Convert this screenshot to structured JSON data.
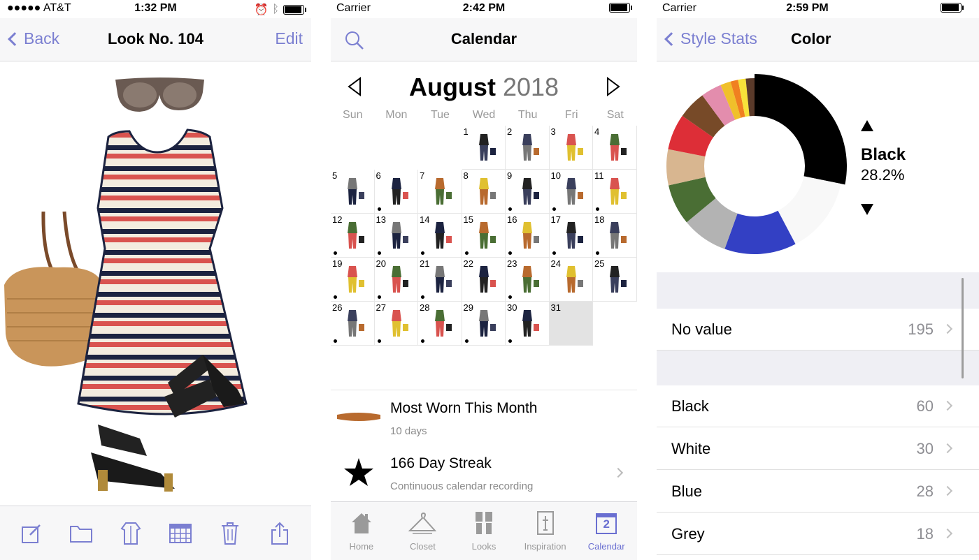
{
  "screen1": {
    "status": {
      "carrier": "●●●●● AT&T",
      "time": "1:32 PM"
    },
    "nav": {
      "back_label": "Back",
      "title": "Look No. 104",
      "edit_label": "Edit"
    },
    "toolbar": [
      "compose-icon",
      "folder-icon",
      "outfit-icon",
      "calendar-grid-icon",
      "trash-icon",
      "share-icon"
    ]
  },
  "screen2": {
    "status": {
      "carrier": "Carrier",
      "time": "2:42 PM"
    },
    "nav": {
      "title": "Calendar"
    },
    "month": "August",
    "year": "2018",
    "weekdays": [
      "Sun",
      "Mon",
      "Tue",
      "Wed",
      "Thu",
      "Fri",
      "Sat"
    ],
    "days": [
      {
        "d": "1"
      },
      {
        "d": "2"
      },
      {
        "d": "3"
      },
      {
        "d": "4"
      },
      {
        "d": "5",
        "dot": false
      },
      {
        "d": "6",
        "dot": true
      },
      {
        "d": "7",
        "dot": false
      },
      {
        "d": "8",
        "dot": false
      },
      {
        "d": "9",
        "dot": true
      },
      {
        "d": "10",
        "dot": true
      },
      {
        "d": "11",
        "dot": true
      },
      {
        "d": "12",
        "dot": true
      },
      {
        "d": "13",
        "dot": true
      },
      {
        "d": "14",
        "dot": true
      },
      {
        "d": "15",
        "dot": true
      },
      {
        "d": "16",
        "dot": true
      },
      {
        "d": "17",
        "dot": true
      },
      {
        "d": "18",
        "dot": true
      },
      {
        "d": "19",
        "dot": true
      },
      {
        "d": "20",
        "dot": true
      },
      {
        "d": "21",
        "dot": true
      },
      {
        "d": "22",
        "dot": false
      },
      {
        "d": "23",
        "dot": true
      },
      {
        "d": "24",
        "dot": false
      },
      {
        "d": "25",
        "dot": false
      },
      {
        "d": "26",
        "dot": true
      },
      {
        "d": "27",
        "dot": true
      },
      {
        "d": "28",
        "dot": true
      },
      {
        "d": "29",
        "dot": true
      },
      {
        "d": "30",
        "dot": true
      },
      {
        "d": "31",
        "dot": false
      }
    ],
    "most_worn": {
      "title": "Most Worn This Month",
      "subtitle": "10 days"
    },
    "streak": {
      "title": "166 Day Streak",
      "subtitle": "Continuous calendar recording"
    },
    "tabs": [
      {
        "label": "Home"
      },
      {
        "label": "Closet"
      },
      {
        "label": "Looks"
      },
      {
        "label": "Inspiration"
      },
      {
        "label": "Calendar",
        "badge": "2"
      }
    ]
  },
  "screen3": {
    "status": {
      "carrier": "Carrier",
      "time": "2:59 PM"
    },
    "nav": {
      "back_label": "Style Stats",
      "title": "Color"
    },
    "selected": {
      "name": "Black",
      "percent": "28.2%"
    },
    "donut": [
      {
        "color": "#000000",
        "value": 28.2
      },
      {
        "color": "#f8f8f8",
        "value": 14.1
      },
      {
        "color": "#3340c4",
        "value": 13.2
      },
      {
        "color": "#b3b3b3",
        "value": 8.5
      },
      {
        "color": "#4a6e34",
        "value": 7.5
      },
      {
        "color": "#d8b690",
        "value": 6.6
      },
      {
        "color": "#dd2e37",
        "value": 6.6
      },
      {
        "color": "#774a28",
        "value": 5.2
      },
      {
        "color": "#e38dad",
        "value": 3.8
      },
      {
        "color": "#f0c02b",
        "value": 1.9
      },
      {
        "color": "#f08020",
        "value": 1.4
      },
      {
        "color": "#f7e23a",
        "value": 1.4
      },
      {
        "color": "#5a3a2a",
        "value": 1.6
      }
    ],
    "no_value": {
      "label": "No value",
      "count": "195"
    },
    "rows": [
      {
        "label": "Black",
        "count": "60"
      },
      {
        "label": "White",
        "count": "30"
      },
      {
        "label": "Blue",
        "count": "28"
      },
      {
        "label": "Grey",
        "count": "18"
      }
    ]
  }
}
